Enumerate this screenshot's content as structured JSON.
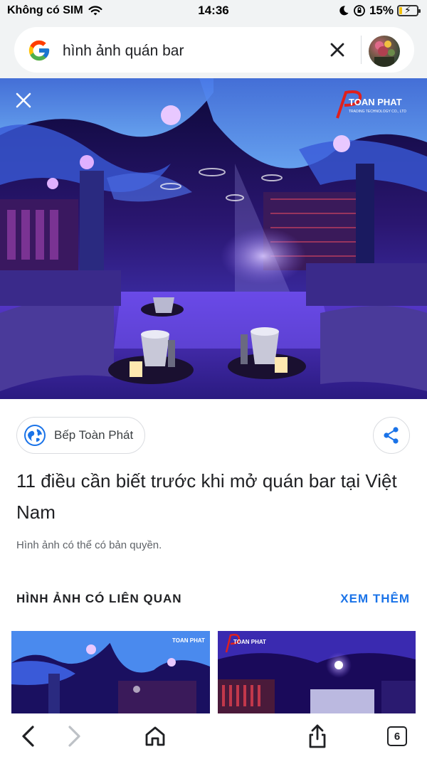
{
  "status_bar": {
    "carrier": "Không có SIM",
    "time": "14:36",
    "battery_percent": "15%",
    "battery_level": 0.15,
    "icons": [
      "wifi-icon",
      "moon-icon",
      "orientation-lock-icon",
      "battery-icon"
    ]
  },
  "search": {
    "query": "hình ảnh quán bar",
    "clear_icon": "close-icon",
    "logo": "google-logo"
  },
  "hero": {
    "close_icon": "close-icon",
    "watermark_brand": "TOAN PHAT",
    "watermark_tagline": "TRADING TECHNOLOGY CO., LTD"
  },
  "source": {
    "name": "Bếp Toàn Phát",
    "icon": "globe-icon"
  },
  "share_icon": "share-icon",
  "article": {
    "title": "11 điều cần biết trước khi mở quán bar tại Việt Nam",
    "copyright_note": "Hình ảnh có thể có bản quyền."
  },
  "related": {
    "heading": "HÌNH ẢNH CÓ LIÊN QUAN",
    "see_more": "XEM THÊM",
    "thumb1_watermark": "TOAN PHAT",
    "thumb2_watermark": "TOAN PHAT"
  },
  "toolbar": {
    "back_icon": "chevron-left-icon",
    "forward_icon": "chevron-right-icon",
    "home_icon": "home-icon",
    "share_icon": "share-upload-icon",
    "tab_count": "6"
  },
  "colors": {
    "accent": "#1a73e8",
    "header_bg": "#f1f3f4",
    "text": "#202124",
    "secondary_text": "#5f6368"
  }
}
